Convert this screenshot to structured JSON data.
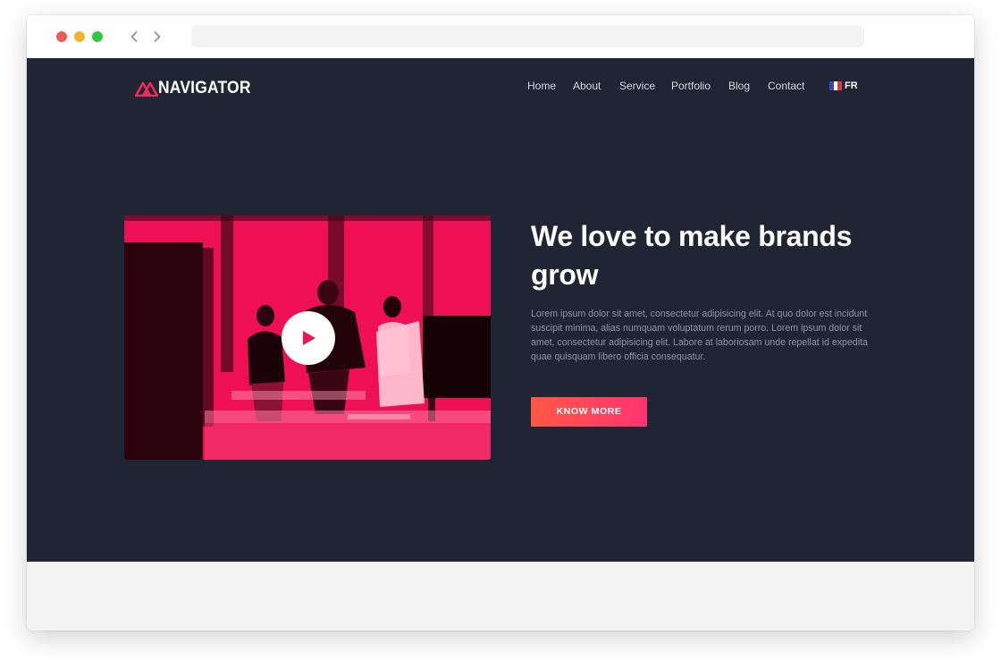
{
  "brand": {
    "name": "NAVIGATOR",
    "logo_icon": "navigator-mountain-logo",
    "accent": "#f0295e"
  },
  "nav": {
    "items": [
      {
        "label": "Home"
      },
      {
        "label": "About"
      },
      {
        "label": "Service"
      },
      {
        "label": "Portfolio"
      },
      {
        "label": "Blog"
      },
      {
        "label": "Contact"
      }
    ],
    "language": {
      "label": "FR",
      "icon": "france-flag-icon"
    }
  },
  "hero": {
    "headline": "We love to make brands grow",
    "body": "Lorem ipsum dolor sit amet, consectetur adipisicing elit. At quo dolor est incidunt suscipit minima, alias numquam voluptatum rerum porro. Lorem ipsum dolor sit amet, consectetur adipisicing elit. Labore at laboriosam unde repellat id expedita quae quisquam libero officia consequatur.",
    "cta_label": "KNOW MORE",
    "video_icon": "play-icon"
  },
  "colors": {
    "background": "#1f2533",
    "cta_start": "#ff5845",
    "cta_end": "#ff3470",
    "photo_tint": "#ef0f55"
  }
}
